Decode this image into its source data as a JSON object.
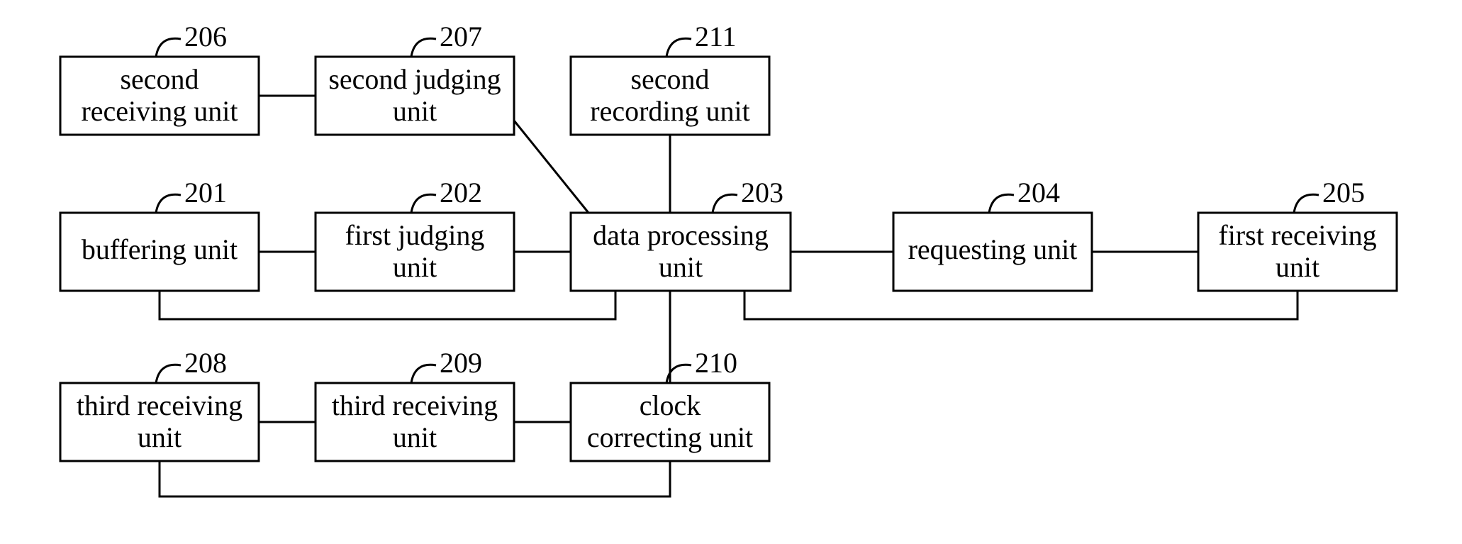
{
  "boxes": {
    "201": {
      "num": "201",
      "line1": "buffering unit"
    },
    "202": {
      "num": "202",
      "line1": "first judging",
      "line2": "unit"
    },
    "203": {
      "num": "203",
      "line1": "data processing",
      "line2": "unit"
    },
    "204": {
      "num": "204",
      "line1": "requesting unit"
    },
    "205": {
      "num": "205",
      "line1": "first receiving",
      "line2": "unit"
    },
    "206": {
      "num": "206",
      "line1": "second",
      "line2": "receiving unit"
    },
    "207": {
      "num": "207",
      "line1": "second judging",
      "line2": "unit"
    },
    "208": {
      "num": "208",
      "line1": "third receiving",
      "line2": "unit"
    },
    "209": {
      "num": "209",
      "line1": "third receiving",
      "line2": "unit"
    },
    "210": {
      "num": "210",
      "line1": "clock",
      "line2": "correcting unit"
    },
    "211": {
      "num": "211",
      "line1": "second",
      "line2": "recording unit"
    }
  }
}
